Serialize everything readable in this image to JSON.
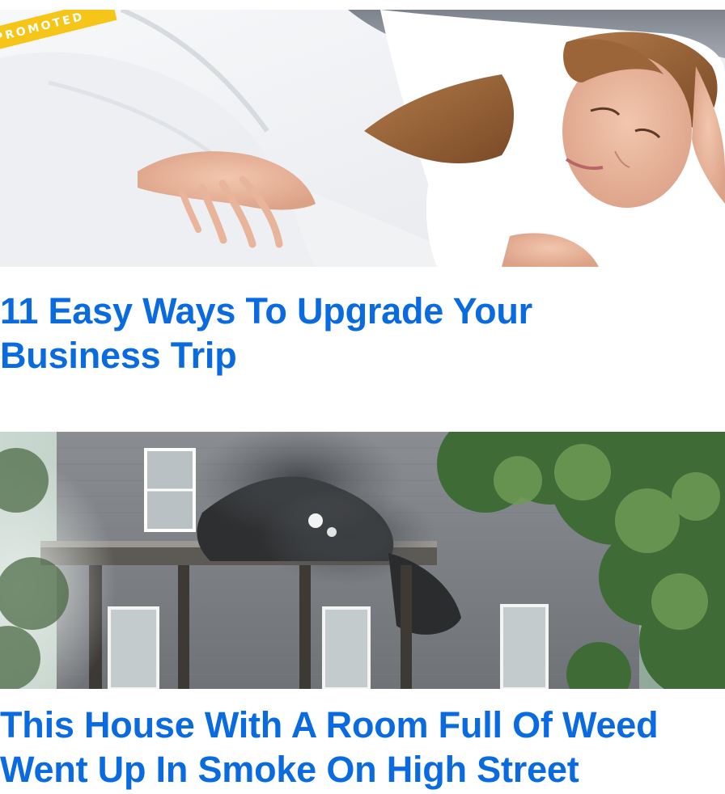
{
  "feed": {
    "items": [
      {
        "badge": "PROMOTED",
        "headline": "11 Easy Ways To Upgrade Your Business Trip",
        "image_icon": "sleeping-woman-bed-image"
      },
      {
        "headline": "This House With A Room Full Of Weed Went Up In Smoke On High Street",
        "image_icon": "burning-house-image"
      }
    ]
  },
  "colors": {
    "headline": "#0a6ae0",
    "badge_background": "#f5c518",
    "badge_text": "#ffffff"
  }
}
